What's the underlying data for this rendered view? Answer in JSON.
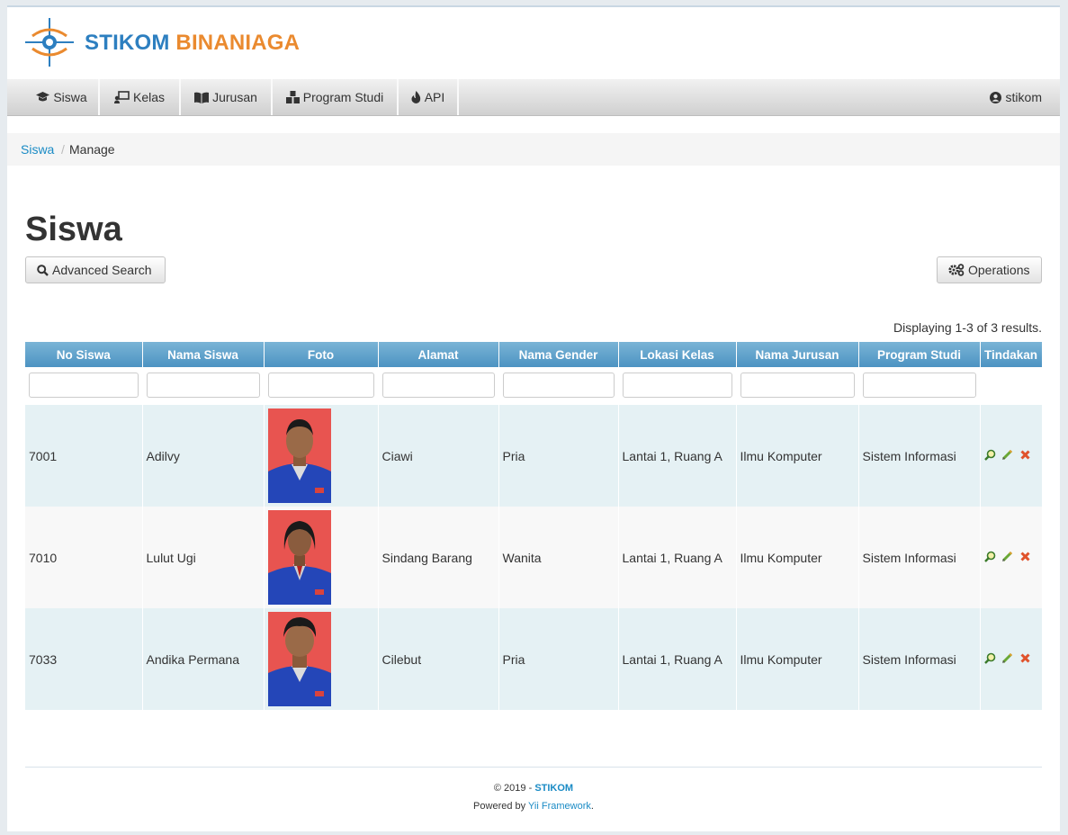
{
  "brand": {
    "part1": "STIKOM",
    "part2": "BINANIAGA"
  },
  "nav": {
    "items": [
      {
        "label": "Siswa",
        "icon": "graduation-cap-icon"
      },
      {
        "label": "Kelas",
        "icon": "chalkboard-teacher-icon"
      },
      {
        "label": "Jurusan",
        "icon": "book-open-icon"
      },
      {
        "label": "Program Studi",
        "icon": "cubes-icon"
      },
      {
        "label": "API",
        "icon": "fire-icon"
      }
    ],
    "user": "stikom"
  },
  "breadcrumb": {
    "link": "Siswa",
    "separator": "/",
    "current": "Manage"
  },
  "page": {
    "title": "Siswa",
    "advanced_search": "Advanced Search",
    "operations": "Operations",
    "summary": "Displaying 1-3 of 3 results."
  },
  "table": {
    "columns": [
      "No Siswa",
      "Nama Siswa",
      "Foto",
      "Alamat",
      "Nama Gender",
      "Lokasi Kelas",
      "Nama Jurusan",
      "Program Studi",
      "Tindakan"
    ],
    "rows": [
      {
        "no": "7001",
        "nama": "Adilvy",
        "alamat": "Ciawi",
        "gender": "Pria",
        "lokasi": "Lantai 1, Ruang A",
        "jurusan": "Ilmu Komputer",
        "prodi": "Sistem Informasi"
      },
      {
        "no": "7010",
        "nama": "Lulut Ugi",
        "alamat": "Sindang Barang",
        "gender": "Wanita",
        "lokasi": "Lantai 1, Ruang A",
        "jurusan": "Ilmu Komputer",
        "prodi": "Sistem Informasi"
      },
      {
        "no": "7033",
        "nama": "Andika Permana",
        "alamat": "Cilebut",
        "gender": "Pria",
        "lokasi": "Lantai 1, Ruang A",
        "jurusan": "Ilmu Komputer",
        "prodi": "Sistem Informasi"
      }
    ]
  },
  "footer": {
    "copyright": "© 2019 - ",
    "brand": "STIKOM",
    "powered": "Powered by ",
    "framework": "Yii Framework",
    "period": "."
  },
  "colors": {
    "header_blue": "#4c93c2",
    "link": "#1a8bc5",
    "brand_blue": "#2d7fc0",
    "brand_orange": "#ea8a2f"
  }
}
